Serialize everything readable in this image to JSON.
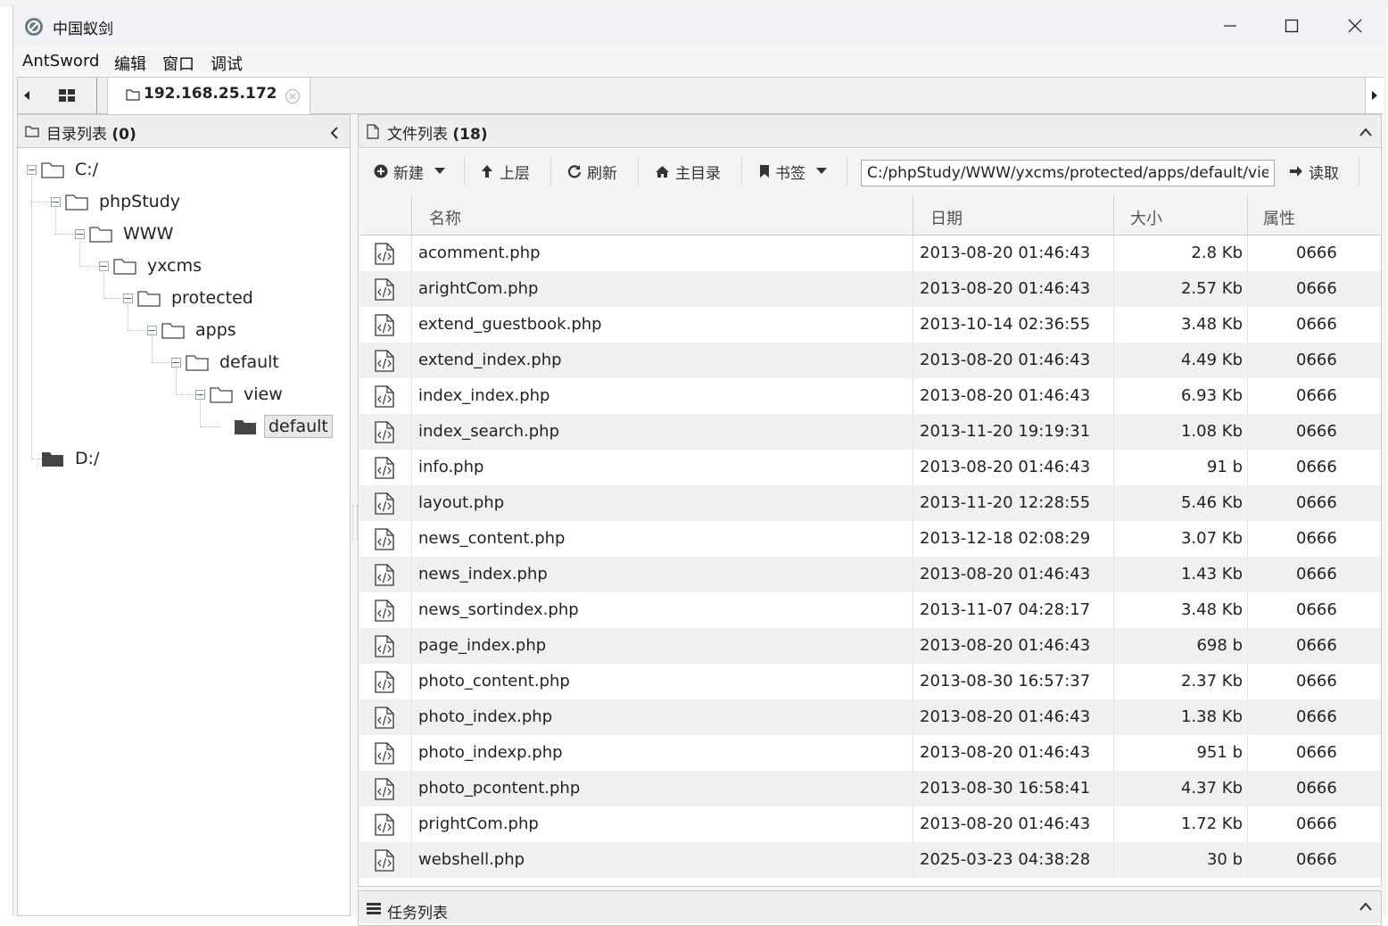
{
  "window": {
    "title": "中国蚁剑"
  },
  "menu": [
    "AntSword",
    "编辑",
    "窗口",
    "调试"
  ],
  "tabs": {
    "active_label": "192.168.25.172"
  },
  "dir_panel": {
    "title": "目录列表",
    "count": "(0)",
    "tree": [
      {
        "label": "C:/",
        "depth": 0,
        "expanded": true,
        "filled": false
      },
      {
        "label": "phpStudy",
        "depth": 1,
        "expanded": true,
        "filled": false
      },
      {
        "label": "WWW",
        "depth": 2,
        "expanded": true,
        "filled": false
      },
      {
        "label": "yxcms",
        "depth": 3,
        "expanded": true,
        "filled": false
      },
      {
        "label": "protected",
        "depth": 4,
        "expanded": true,
        "filled": false
      },
      {
        "label": "apps",
        "depth": 5,
        "expanded": true,
        "filled": false
      },
      {
        "label": "default",
        "depth": 6,
        "expanded": true,
        "filled": false
      },
      {
        "label": "view",
        "depth": 7,
        "expanded": true,
        "filled": false
      },
      {
        "label": "default",
        "depth": 8,
        "expanded": false,
        "filled": true,
        "selected": true
      },
      {
        "label": "D:/",
        "depth": 0,
        "expanded": false,
        "filled": true
      }
    ]
  },
  "file_panel": {
    "title": "文件列表",
    "count": "(18)",
    "toolbar": {
      "new": "新建",
      "up": "上层",
      "refresh": "刷新",
      "home": "主目录",
      "bookmark": "书签",
      "path": "C:/phpStudy/WWW/yxcms/protected/apps/default/view/default/",
      "read": "读取"
    },
    "columns": {
      "name": "名称",
      "date": "日期",
      "size": "大小",
      "perm": "属性"
    },
    "files": [
      {
        "name": "acomment.php",
        "date": "2013-08-20 01:46:43",
        "size": "2.8 Kb",
        "perm": "0666"
      },
      {
        "name": "arightCom.php",
        "date": "2013-08-20 01:46:43",
        "size": "2.57 Kb",
        "perm": "0666"
      },
      {
        "name": "extend_guestbook.php",
        "date": "2013-10-14 02:36:55",
        "size": "3.48 Kb",
        "perm": "0666"
      },
      {
        "name": "extend_index.php",
        "date": "2013-08-20 01:46:43",
        "size": "4.49 Kb",
        "perm": "0666"
      },
      {
        "name": "index_index.php",
        "date": "2013-08-20 01:46:43",
        "size": "6.93 Kb",
        "perm": "0666"
      },
      {
        "name": "index_search.php",
        "date": "2013-11-20 19:19:31",
        "size": "1.08 Kb",
        "perm": "0666"
      },
      {
        "name": "info.php",
        "date": "2013-08-20 01:46:43",
        "size": "91 b",
        "perm": "0666"
      },
      {
        "name": "layout.php",
        "date": "2013-11-20 12:28:55",
        "size": "5.46 Kb",
        "perm": "0666"
      },
      {
        "name": "news_content.php",
        "date": "2013-12-18 02:08:29",
        "size": "3.07 Kb",
        "perm": "0666"
      },
      {
        "name": "news_index.php",
        "date": "2013-08-20 01:46:43",
        "size": "1.43 Kb",
        "perm": "0666"
      },
      {
        "name": "news_sortindex.php",
        "date": "2013-11-07 04:28:17",
        "size": "3.48 Kb",
        "perm": "0666"
      },
      {
        "name": "page_index.php",
        "date": "2013-08-20 01:46:43",
        "size": "698 b",
        "perm": "0666"
      },
      {
        "name": "photo_content.php",
        "date": "2013-08-30 16:57:37",
        "size": "2.37 Kb",
        "perm": "0666"
      },
      {
        "name": "photo_index.php",
        "date": "2013-08-20 01:46:43",
        "size": "1.38 Kb",
        "perm": "0666"
      },
      {
        "name": "photo_indexp.php",
        "date": "2013-08-20 01:46:43",
        "size": "951 b",
        "perm": "0666"
      },
      {
        "name": "photo_pcontent.php",
        "date": "2013-08-30 16:58:41",
        "size": "4.37 Kb",
        "perm": "0666"
      },
      {
        "name": "prightCom.php",
        "date": "2013-08-20 01:46:43",
        "size": "1.72 Kb",
        "perm": "0666"
      },
      {
        "name": "webshell.php",
        "date": "2025-03-23 04:38:28",
        "size": "30 b",
        "perm": "0666"
      }
    ]
  },
  "task_panel": {
    "title": "任务列表"
  }
}
